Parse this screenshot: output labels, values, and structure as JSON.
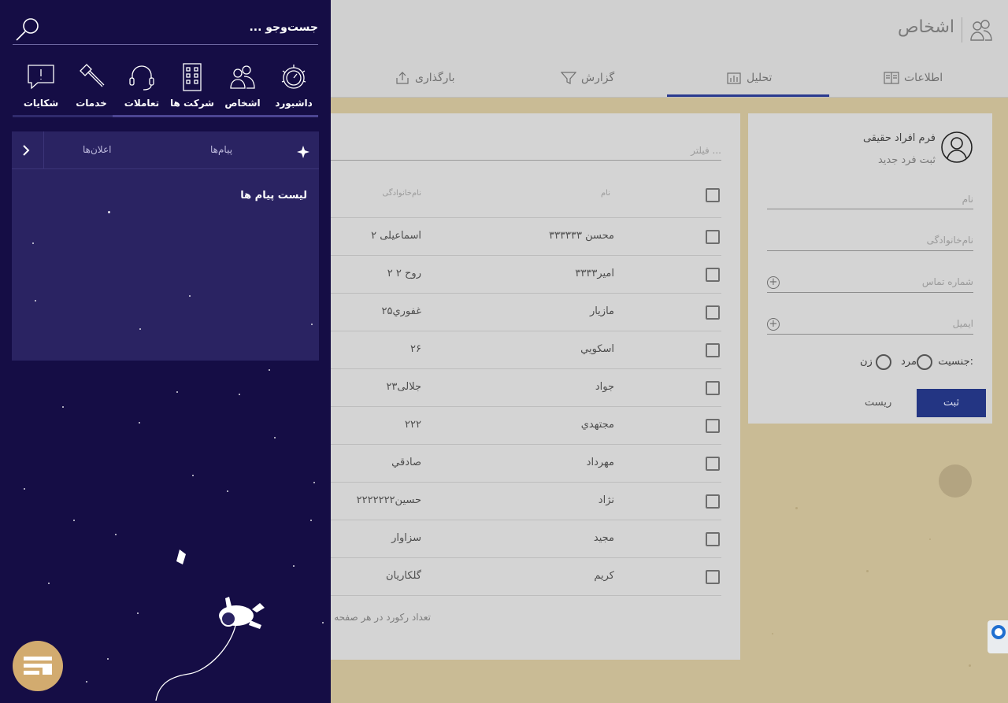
{
  "header": {
    "title": "اشخاص",
    "icon": "people-icon"
  },
  "tabs": [
    {
      "label": "اطلاعات",
      "icon": "book-icon"
    },
    {
      "label": "تحلیل",
      "icon": "chart-icon",
      "active": true
    },
    {
      "label": "گزارش",
      "icon": "filter-icon"
    },
    {
      "label": "بارگذاری",
      "icon": "upload-icon"
    }
  ],
  "list": {
    "filter_placeholder": "فیلتر ...",
    "col_first": "نام",
    "col_last": "نام‌خانوادگی",
    "rows": [
      {
        "first": "محسن ۳۳۳۳۳۳",
        "last": "اسماعیلی ۲"
      },
      {
        "first": "امیر۳۳۳۳",
        "last": "روح ۲ ۲"
      },
      {
        "first": "مازیار",
        "last": "غفوري۲۵"
      },
      {
        "first": "اسکويي",
        "last": "۲۶"
      },
      {
        "first": "جواد",
        "last": "جلالی۲۳"
      },
      {
        "first": "مجتهدي",
        "last": "۲۲۲"
      },
      {
        "first": "مهرداد",
        "last": "صادقي"
      },
      {
        "first": "نژاد",
        "last": "حسین۲۲۲۲۲۲۲"
      },
      {
        "first": "مجید",
        "last": "سزاوار"
      },
      {
        "first": "کریم",
        "last": "گلکاریان"
      }
    ],
    "footer_text": "تعداد رکورد در هر صفحه"
  },
  "form": {
    "title": "فرم افراد حقیقی",
    "subtitle": "ثبت فرد جدید",
    "first_name": "نام",
    "last_name": "نام‌خانوادگی",
    "phone": "شماره تماس",
    "email": "ایمیل",
    "gender_label": "جنسیت:",
    "gender_male": "مرد",
    "gender_female": "زن",
    "submit": "ثبت",
    "reset": "ریست"
  },
  "menu": {
    "search_placeholder": "جست‌وجو ...",
    "items": [
      {
        "label": "داشبورد",
        "icon": "dashboard-gear-icon"
      },
      {
        "label": "اشخاص",
        "icon": "people-icon"
      },
      {
        "label": "شرکت ها",
        "icon": "building-icon"
      },
      {
        "label": "تعاملات",
        "icon": "headset-icon"
      },
      {
        "label": "خدمات",
        "icon": "hammer-icon"
      },
      {
        "label": "شکایات",
        "icon": "complaint-icon"
      }
    ],
    "messages_tab": "پیام‌ها",
    "announcements_tab": "اعلان‌ها",
    "messages_title": "لیست پیام ها"
  },
  "colors": {
    "menu_bg": "#150d45",
    "panel_bg": "#2a2362",
    "accent": "#233583",
    "logo": "#d2ab6f"
  }
}
